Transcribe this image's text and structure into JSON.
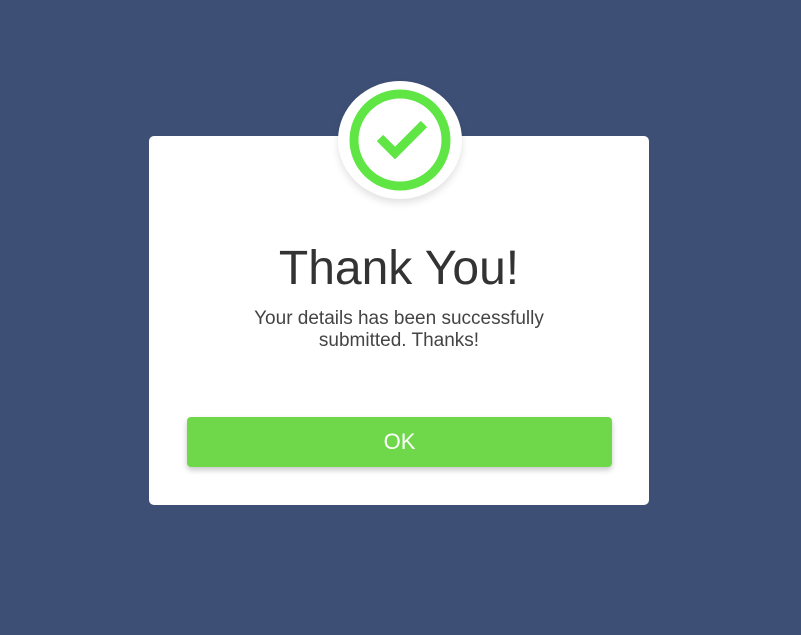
{
  "dialog": {
    "title": "Thank You!",
    "message": "Your details has been successfully submitted. Thanks!",
    "ok_label": "OK"
  },
  "icons": {
    "badge": "check-circle-icon"
  },
  "colors": {
    "background": "#3d4f75",
    "accent": "#6fd84a",
    "check": "#5fe645",
    "title_text": "#333333"
  }
}
